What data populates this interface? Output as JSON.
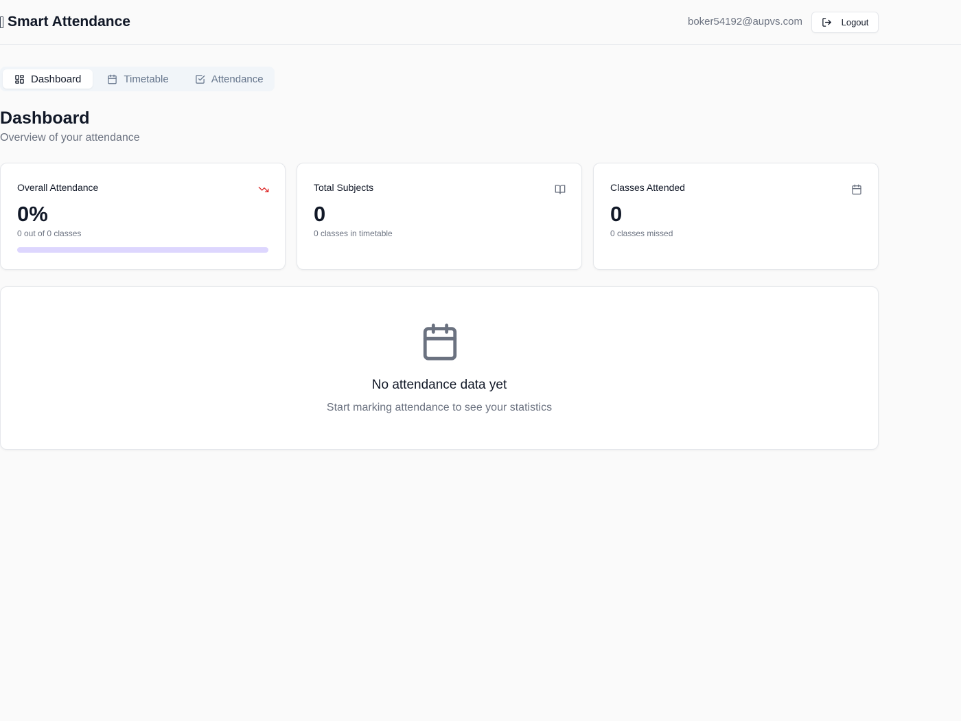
{
  "app": {
    "title": "Smart Attendance",
    "user_email": "boker54192@aupvs.com",
    "logout_label": "Logout"
  },
  "tabs": [
    {
      "label": "Dashboard",
      "icon": "layout-grid-icon",
      "active": true
    },
    {
      "label": "Timetable",
      "icon": "calendar-icon",
      "active": false
    },
    {
      "label": "Attendance",
      "icon": "check-square-icon",
      "active": false
    }
  ],
  "page": {
    "title": "Dashboard",
    "subtitle": "Overview of your attendance"
  },
  "stats": [
    {
      "title": "Overall Attendance",
      "value": "0%",
      "sub": "0 out of 0 classes",
      "icon": "trending-down-icon",
      "progress": 0
    },
    {
      "title": "Total Subjects",
      "value": "0",
      "sub": "0 classes in timetable",
      "icon": "book-open-icon"
    },
    {
      "title": "Classes Attended",
      "value": "0",
      "sub": "0 classes missed",
      "icon": "calendar-icon"
    }
  ],
  "empty_state": {
    "icon": "calendar-icon",
    "title": "No attendance data yet",
    "subtitle": "Start marking attendance to see your statistics"
  },
  "colors": {
    "accent": "#7c3aed",
    "progress_track": "#ddd6fe",
    "trend_down": "#dc2626",
    "muted_text": "#6b7280"
  }
}
